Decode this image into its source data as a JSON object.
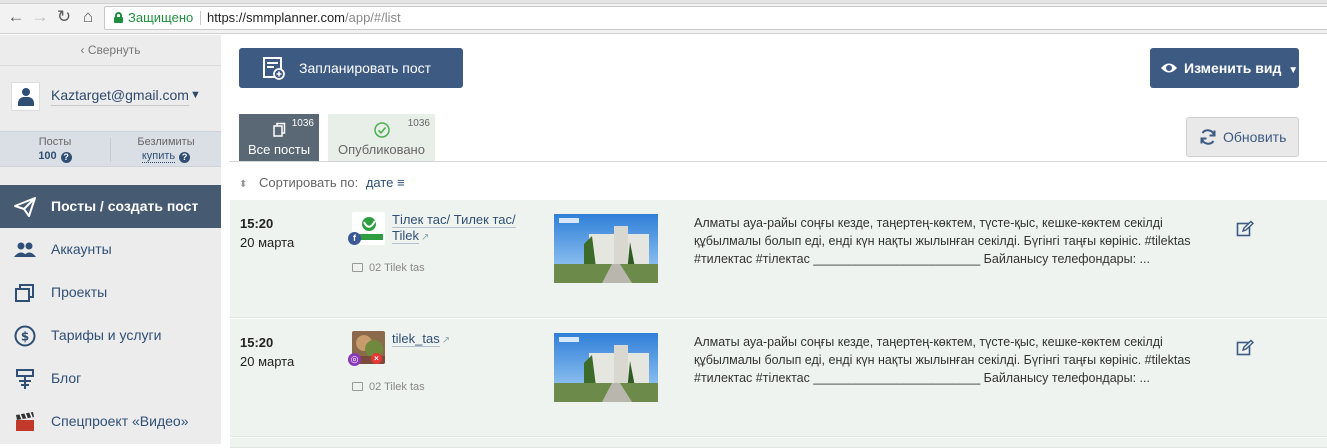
{
  "browser": {
    "secure_label": "Защищено",
    "url_host": "https://smmplanner.com",
    "url_path": "/app/#/list"
  },
  "sidebar": {
    "collapse_label": "‹ Свернуть",
    "user_email": "Kaztarget@gmail.com",
    "stats": [
      {
        "label": "Посты",
        "value": "100"
      },
      {
        "label": "Безлимиты",
        "value": "купить"
      }
    ],
    "menu": [
      {
        "label": "Посты / создать пост",
        "icon": "send-icon",
        "active": true
      },
      {
        "label": "Аккаунты",
        "icon": "users-icon"
      },
      {
        "label": "Проекты",
        "icon": "projects-icon"
      },
      {
        "label": "Тарифы и услуги",
        "icon": "dollar-icon"
      },
      {
        "label": "Блог",
        "icon": "blog-icon"
      },
      {
        "label": "Спецпроект «Видео»",
        "icon": "clapperboard-icon"
      }
    ]
  },
  "main": {
    "plan_button": "Запланировать пост",
    "view_button": "Изменить вид",
    "refresh_button": "Обновить",
    "tabs": [
      {
        "label": "Все посты",
        "count": "1036",
        "icon": "copy-icon"
      },
      {
        "label": "Опубликовано",
        "count": "1036",
        "icon": "check-circle-icon"
      }
    ],
    "sort_label": "Сортировать по:",
    "sort_value": "дате"
  },
  "posts": [
    {
      "time": "15:20",
      "date": "20 марта",
      "account": "Тілек тас/ Тилек тас/ Tilek",
      "network": "facebook",
      "project": "02 Tilek tas",
      "text": "Алматы ауа-райы соңғы кезде, таңертең-көктем, түсте-қыс, кешке-көктем секілді құбылмалы болып еді, енді күн нақты жылынған секілді. Бүгінгі таңғы көрініс. #tilektas #тилектас #тілектас ________________________ Байланысу телефондары: ..."
    },
    {
      "time": "15:20",
      "date": "20 марта",
      "account": "tilek_tas",
      "network": "instagram",
      "project": "02 Tilek tas",
      "text": "Алматы ауа-райы соңғы кезде, таңертең-көктем, түсте-қыс, кешке-көктем секілді құбылмалы болып еді, енді күн нақты жылынған секілді. Бүгінгі таңғы көрініс. #tilektas #тилектас #тілектас ________________________ Байланысу телефондары: ..."
    }
  ],
  "colors": {
    "primary": "#3c5a82",
    "sidebar_active": "#465a72",
    "post_bg": "#eef3ef",
    "secure_green": "#1e8e3e"
  }
}
